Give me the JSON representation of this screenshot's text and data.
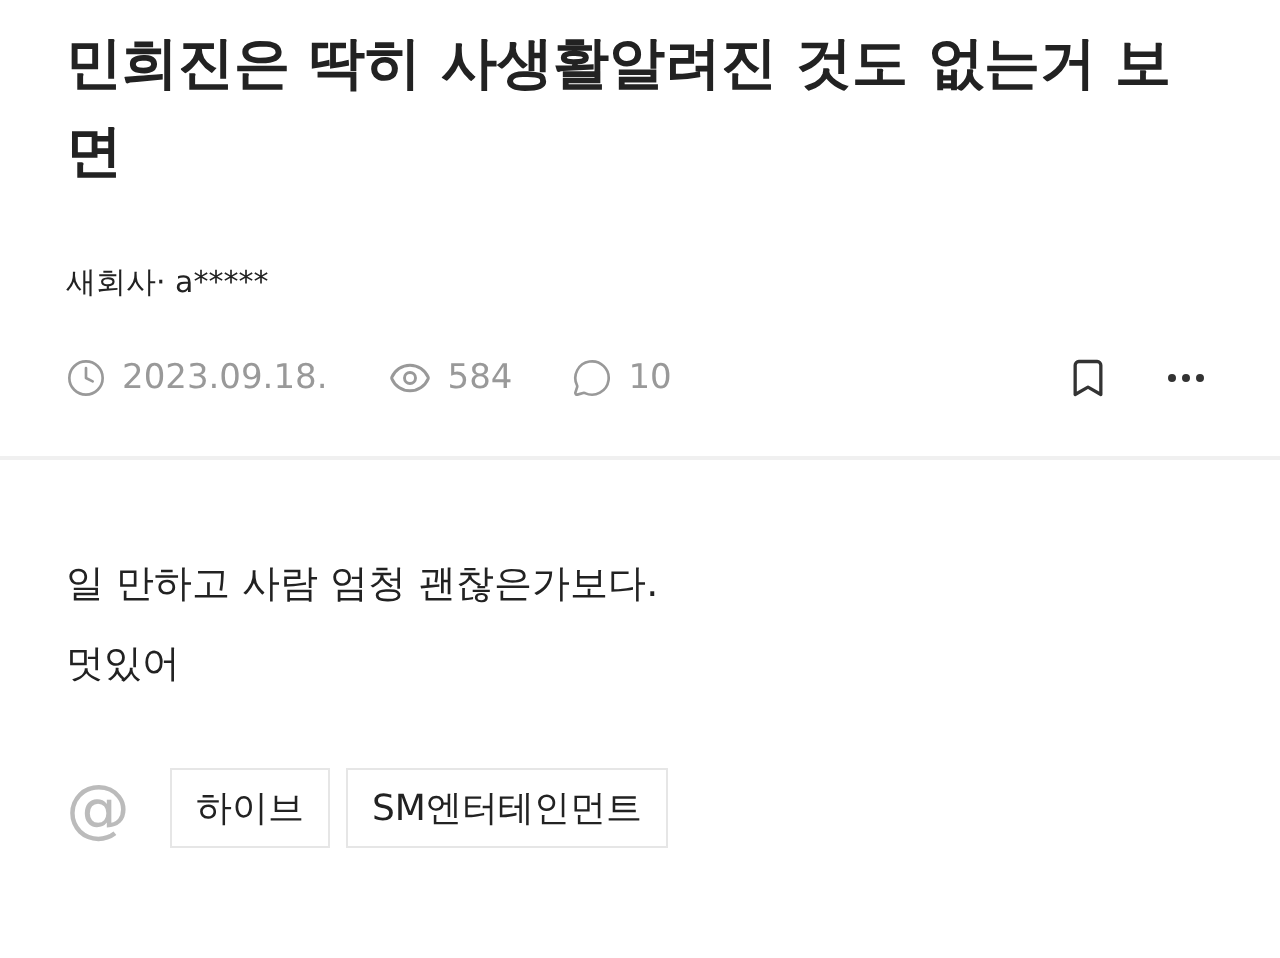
{
  "post": {
    "title": "민희진은 딱히 사생활알려진 것도 없는거 보면",
    "author": "새회사· a*****",
    "date": "2023.09.18.",
    "views": "584",
    "comments": "10"
  },
  "body": [
    "일 만하고 사람 엄청 괜찮은가보다.",
    "멋있어"
  ],
  "mention_icon": "@",
  "tags": [
    "하이브",
    "SM엔터테인먼트"
  ]
}
